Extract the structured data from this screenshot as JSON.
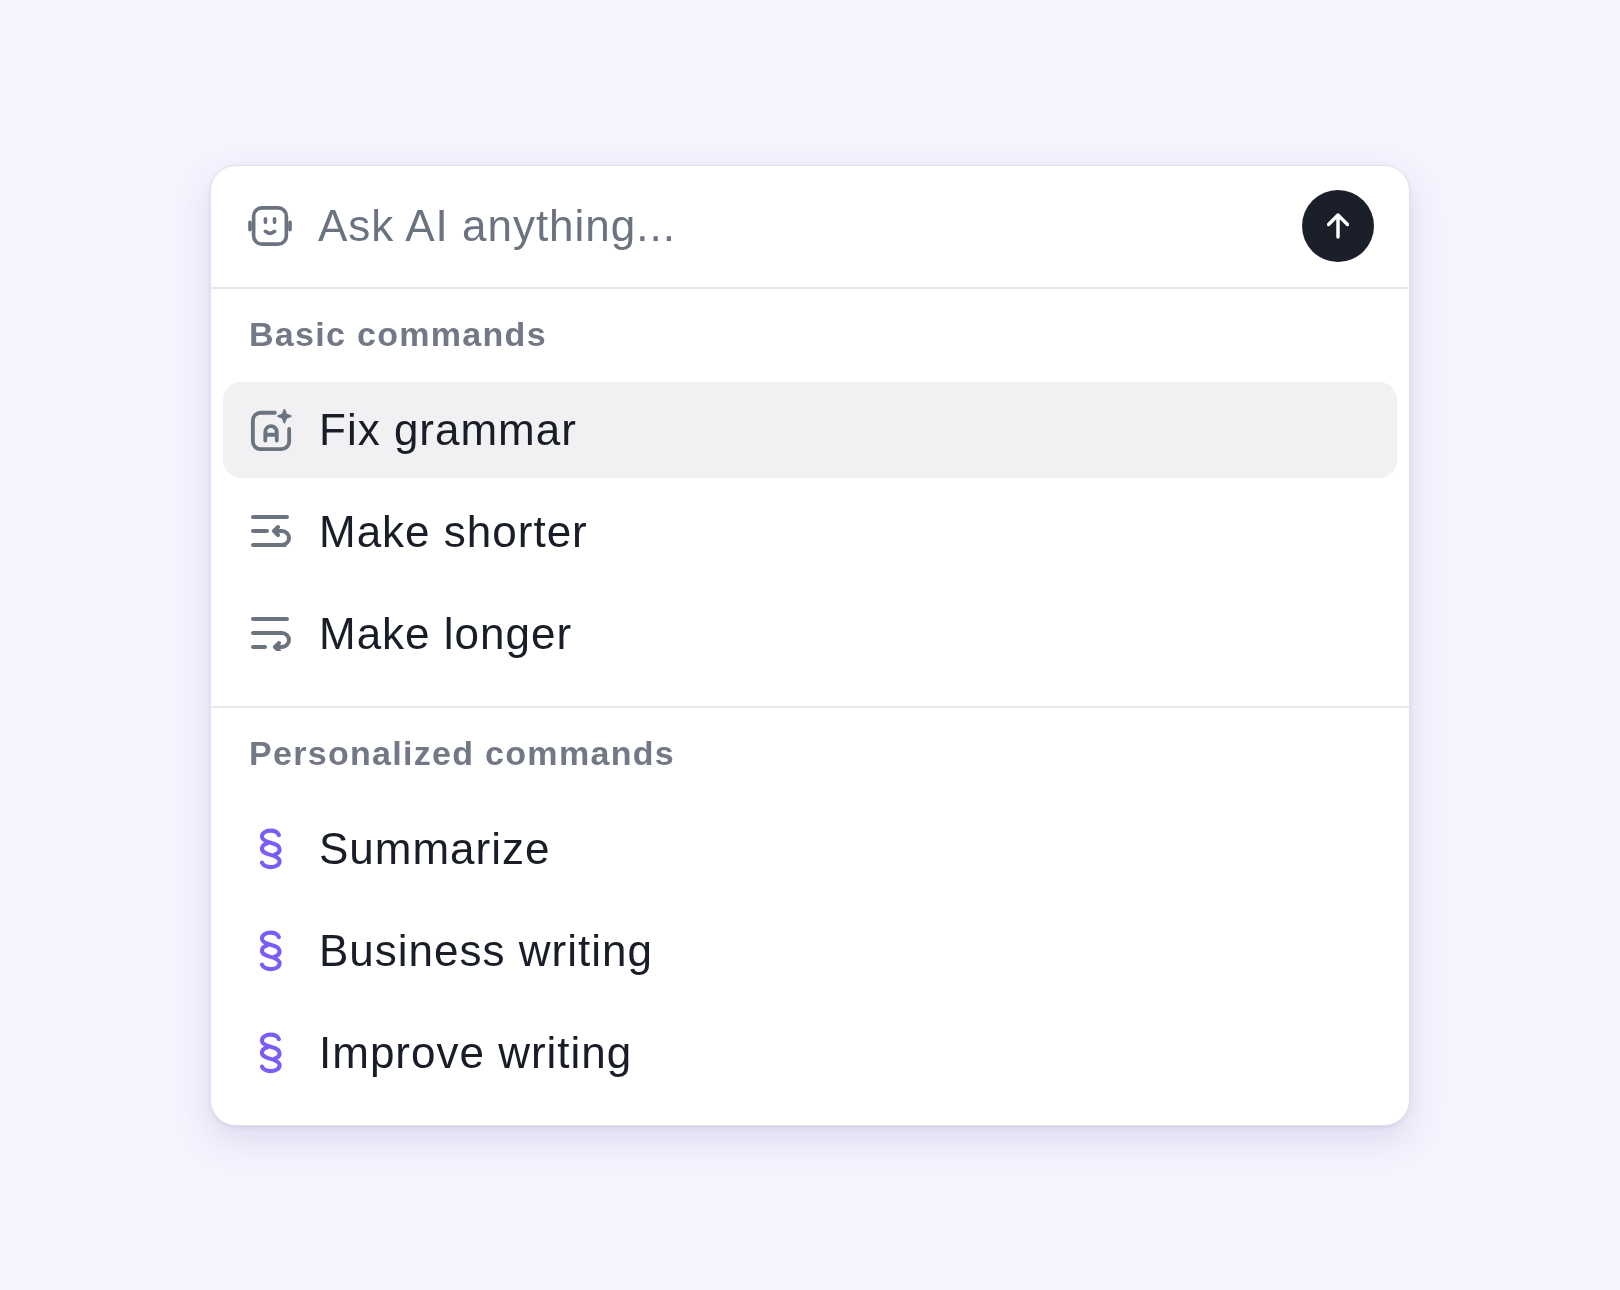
{
  "prompt": {
    "placeholder": "Ask AI anything..."
  },
  "sections": [
    {
      "heading": "Basic commands",
      "items": [
        {
          "label": "Fix grammar",
          "selected": true
        },
        {
          "label": "Make shorter",
          "selected": false
        },
        {
          "label": "Make longer",
          "selected": false
        }
      ]
    },
    {
      "heading": "Personalized commands",
      "items": [
        {
          "label": "Summarize",
          "selected": false
        },
        {
          "label": "Business writing",
          "selected": false
        },
        {
          "label": "Improve writing",
          "selected": false
        }
      ]
    }
  ]
}
